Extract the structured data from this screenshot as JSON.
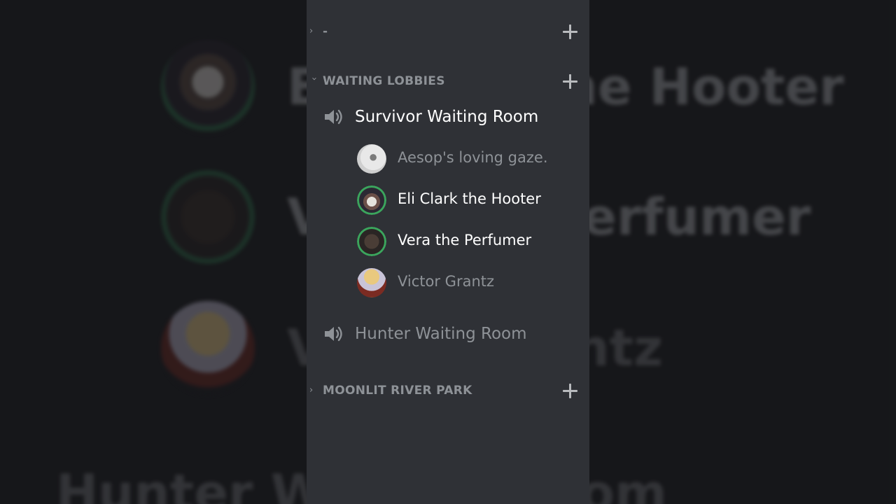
{
  "categories": [
    {
      "label": "-",
      "collapsed": true
    },
    {
      "label": "WAITING LOBBIES",
      "collapsed": false
    },
    {
      "label": "MOONLIT RIVER PARK",
      "collapsed": true
    }
  ],
  "channels": [
    {
      "label": "Survivor Waiting Room",
      "active": true,
      "icon": "speaker-icon"
    },
    {
      "label": "Hunter Waiting Room",
      "active": false,
      "icon": "speaker-icon"
    }
  ],
  "members": [
    {
      "name": "Aesop's loving gaze.",
      "speaking": false,
      "muted_text": true
    },
    {
      "name": "Eli Clark the Hooter",
      "speaking": true,
      "muted_text": false
    },
    {
      "name": "Vera the Perfumer",
      "speaking": true,
      "muted_text": false
    },
    {
      "name": "Victor Grantz",
      "speaking": false,
      "muted_text": true
    }
  ],
  "background_zoom": {
    "texts": [
      "Eli Clark the Hooter",
      "Vera the Perfumer",
      "Victor Grantz",
      "Hunter Waiting Room"
    ]
  },
  "colors": {
    "panel": "#2f3136",
    "speaking_ring": "#3ba55d",
    "text_active": "#ffffff",
    "text_muted": "#8e9297"
  }
}
